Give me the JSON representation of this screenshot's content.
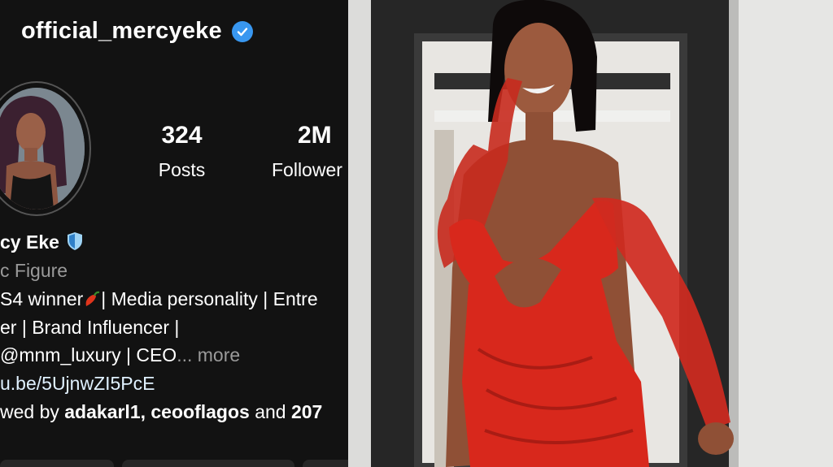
{
  "profile": {
    "username": "official_mercyeke",
    "display_name": "cy Eke",
    "category": "c Figure",
    "bio_line1_a": "S4 winner",
    "bio_line1_b": "| Media personality | Entre",
    "bio_line2": "er | Brand Influencer |",
    "bio_line3": "@mnm_luxury | CEO",
    "more_label": "... more",
    "link_text": "u.be/5UjnwZI5PcE",
    "followed_prefix": "wed by ",
    "followed_names": "adakarl1, ceooflagos",
    "followed_and": " and ",
    "followed_count": "207"
  },
  "stats": {
    "posts_value": "324",
    "posts_label": "Posts",
    "followers_value": "2M",
    "followers_label": "Follower"
  },
  "icons": {
    "verified": "verified-badge-icon",
    "shield": "shield-icon",
    "pepper": "chili-pepper-icon"
  },
  "colors": {
    "background": "#121212",
    "verified_blue": "#3897f0",
    "muted_text": "#9a9a9a",
    "dress_red": "#d8281c"
  }
}
